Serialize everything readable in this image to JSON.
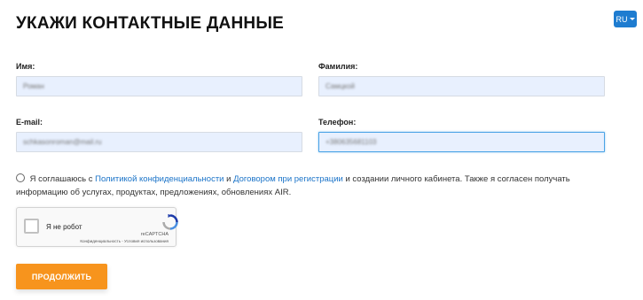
{
  "page": {
    "title": "УКАЖИ КОНТАКТНЫЕ ДАННЫЕ"
  },
  "language": {
    "current": "RU"
  },
  "form": {
    "first_name": {
      "label": "Имя:",
      "value": "Роман"
    },
    "last_name": {
      "label": "Фамилия:",
      "value": "Самцкой"
    },
    "email": {
      "label": "E-mail:",
      "value": "schkasonroman@mail.ru"
    },
    "phone": {
      "label": "Телефон:",
      "value": "+380635681103"
    }
  },
  "consent": {
    "text_before": "Я соглашаюсь с",
    "link_privacy": "Политикой конфиденциальности",
    "text_and": "и",
    "link_agreement": "Договором при регистрации",
    "text_after": "и создании личного кабинета. Также я согласен получать информацию об услугах, продуктах, предложениях, обновлениях AIR."
  },
  "recaptcha": {
    "label": "Я не робот",
    "brand": "reCAPTCHA",
    "terms": "Конфиденциальность - Условия использования"
  },
  "actions": {
    "continue_label": "ПРОДОЛЖИТЬ"
  },
  "colors": {
    "accent_button": "#f7941d",
    "link": "#1a73c8",
    "lang_button": "#1e7cd0",
    "autofill_bg": "#e8f0fe"
  }
}
